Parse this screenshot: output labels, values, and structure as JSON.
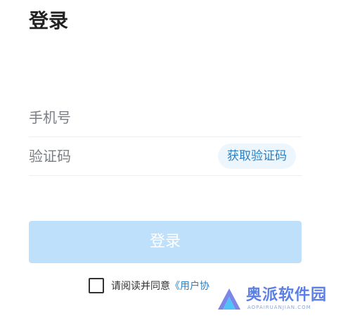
{
  "header": {
    "title": "登录"
  },
  "form": {
    "phone_placeholder": "手机号",
    "code_placeholder": "验证码",
    "get_code_label": "获取验证码",
    "login_label": "登录"
  },
  "agreement": {
    "prefix": "请阅读并同意",
    "link_text": "《用户协",
    "checked": false
  },
  "watermark": {
    "name": "奥派软件园",
    "domain": "AOPAIRUANJIAN.COM"
  },
  "colors": {
    "accent": "#2d7fc0",
    "login_button_bg": "#bfe0fb",
    "get_code_bg": "#eef6fd",
    "watermark": "#5b7fe3"
  }
}
